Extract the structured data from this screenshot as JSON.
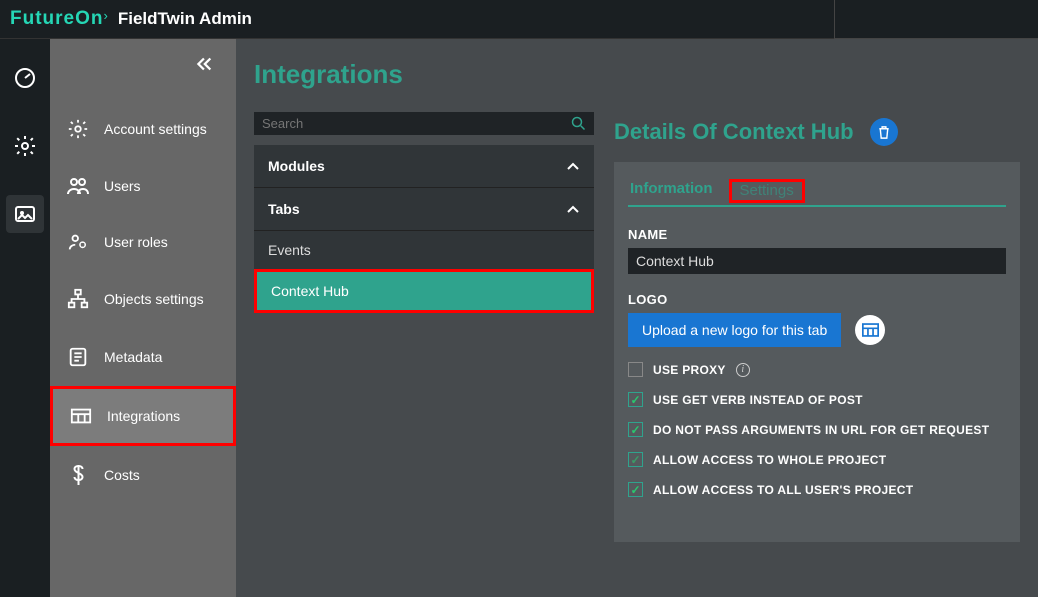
{
  "brand": {
    "left": "FutureOn",
    "right": "FieldTwin Admin"
  },
  "sidebar": {
    "items": [
      {
        "label": "Account settings"
      },
      {
        "label": "Users"
      },
      {
        "label": "User roles"
      },
      {
        "label": "Objects settings"
      },
      {
        "label": "Metadata"
      },
      {
        "label": "Integrations"
      },
      {
        "label": "Costs"
      }
    ]
  },
  "page": {
    "title": "Integrations",
    "search_placeholder": "Search"
  },
  "mid": {
    "modules_label": "Modules",
    "tabs_label": "Tabs",
    "tabs_items": [
      {
        "label": "Events"
      },
      {
        "label": "Context Hub"
      }
    ]
  },
  "details": {
    "title": "Details Of Context Hub",
    "tabs": {
      "info": "Information",
      "settings": "Settings"
    },
    "name_label": "NAME",
    "name_value": "Context Hub",
    "logo_label": "LOGO",
    "upload_label": "Upload a new logo for this tab",
    "checks": {
      "use_proxy": "USE PROXY",
      "use_get": "USE GET VERB INSTEAD OF POST",
      "no_args": "DO NOT PASS ARGUMENTS IN URL FOR GET REQUEST",
      "whole_proj": "ALLOW ACCESS TO WHOLE PROJECT",
      "all_users": "ALLOW ACCESS TO ALL USER'S PROJECT"
    }
  }
}
